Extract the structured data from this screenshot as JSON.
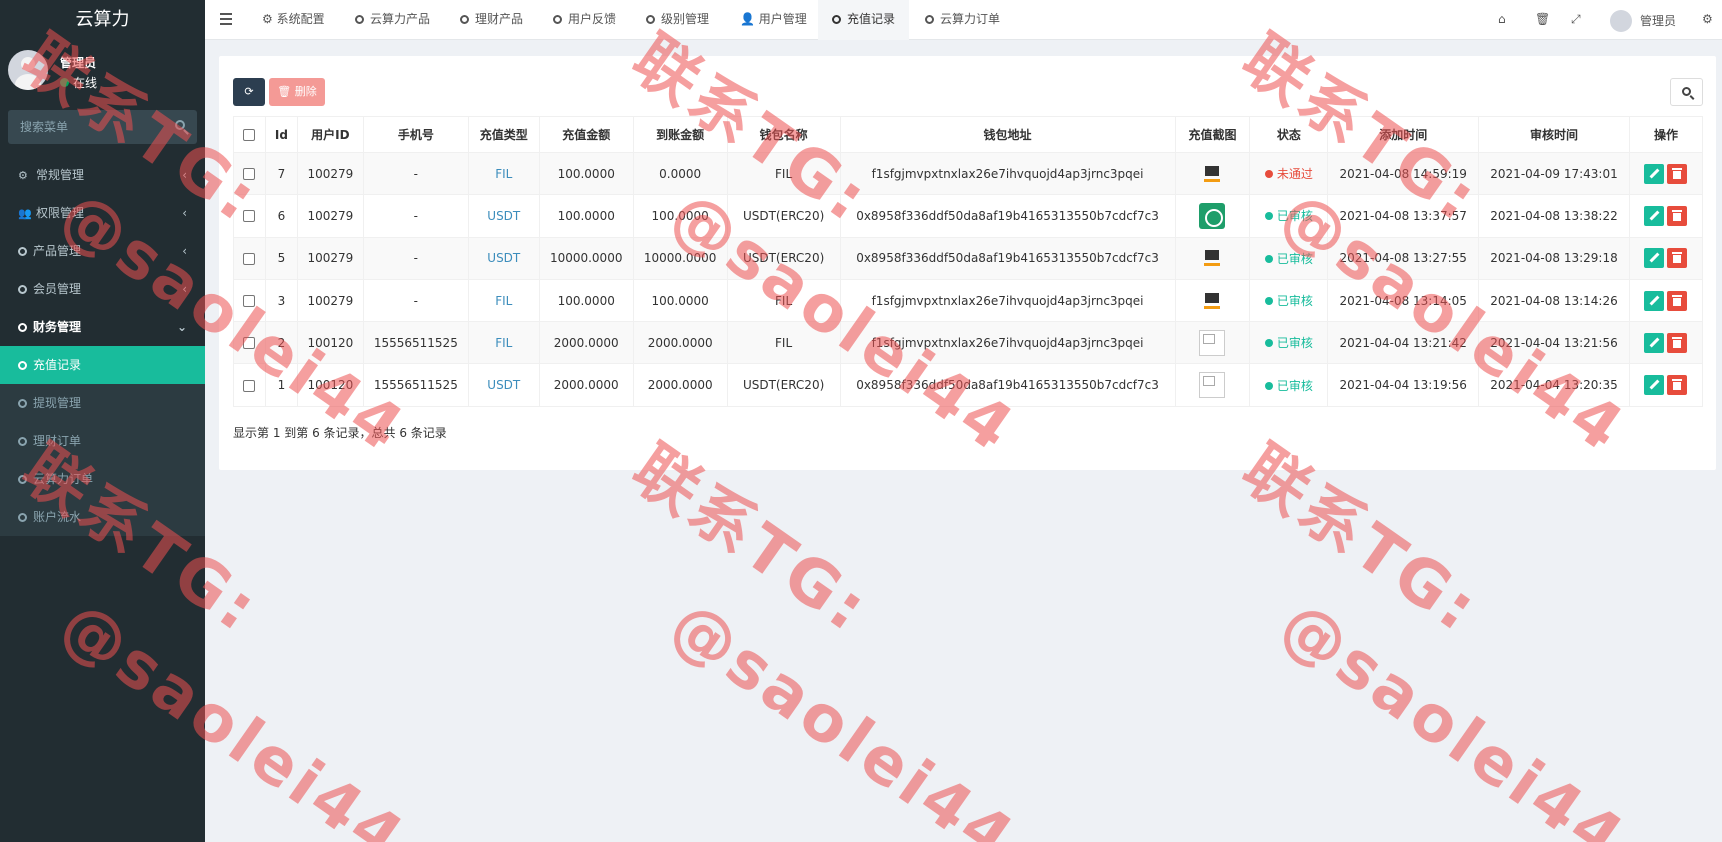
{
  "sidebar": {
    "brand": "云算力",
    "user": {
      "name": "管理员",
      "status": "在线"
    },
    "search_placeholder": "搜索菜单",
    "menu": [
      {
        "label": "常规管理",
        "icon": "cogs-icon"
      },
      {
        "label": "权限管理",
        "icon": "users-icon"
      },
      {
        "label": "产品管理",
        "icon": "circle-icon"
      },
      {
        "label": "会员管理",
        "icon": "circle-icon"
      },
      {
        "label": "财务管理",
        "icon": "circle-icon"
      }
    ],
    "submenu": [
      {
        "label": "充值记录"
      },
      {
        "label": "提现管理"
      },
      {
        "label": "理财订单"
      },
      {
        "label": "云算力订单"
      },
      {
        "label": "账户流水"
      }
    ]
  },
  "topnav": {
    "tabs": [
      {
        "label": "系统配置"
      },
      {
        "label": "云算力产品"
      },
      {
        "label": "理财产品"
      },
      {
        "label": "用户反馈"
      },
      {
        "label": "级别管理"
      },
      {
        "label": "用户管理"
      },
      {
        "label": "充值记录"
      },
      {
        "label": "云算力订单"
      }
    ],
    "user_name": "管理员"
  },
  "toolbar": {
    "delete_label": "删除"
  },
  "table": {
    "columns": [
      "Id",
      "用户ID",
      "手机号",
      "充值类型",
      "充值金额",
      "到账金额",
      "钱包名称",
      "钱包地址",
      "充值截图",
      "状态",
      "添加时间",
      "审核时间",
      "操作"
    ],
    "rows": [
      {
        "id": "7",
        "uid": "100279",
        "phone": "-",
        "type": "FIL",
        "amount": "100.0000",
        "credited": "0.0000",
        "wallet": "FIL",
        "address": "f1sfgjmvpxtnxlax26e7ihvquojd4ap3jrnc3pqei",
        "shot": "monitor",
        "status": "未通过",
        "status_kind": "rej",
        "added": "2021-04-08 14:59:19",
        "reviewed": "2021-04-09 17:43:01"
      },
      {
        "id": "6",
        "uid": "100279",
        "phone": "-",
        "type": "USDT",
        "amount": "100.0000",
        "credited": "100.0000",
        "wallet": "USDT(ERC20)",
        "address": "0x8958f336ddf50da8af19b4165313550b7cdcf7c3",
        "shot": "green",
        "status": "已审核",
        "status_kind": "ok",
        "added": "2021-04-08 13:37:57",
        "reviewed": "2021-04-08 13:38:22"
      },
      {
        "id": "5",
        "uid": "100279",
        "phone": "-",
        "type": "USDT",
        "amount": "10000.0000",
        "credited": "10000.0000",
        "wallet": "USDT(ERC20)",
        "address": "0x8958f336ddf50da8af19b4165313550b7cdcf7c3",
        "shot": "monitor",
        "status": "已审核",
        "status_kind": "ok",
        "added": "2021-04-08 13:27:55",
        "reviewed": "2021-04-08 13:29:18"
      },
      {
        "id": "3",
        "uid": "100279",
        "phone": "-",
        "type": "FIL",
        "amount": "100.0000",
        "credited": "100.0000",
        "wallet": "FIL",
        "address": "f1sfgjmvpxtnxlax26e7ihvquojd4ap3jrnc3pqei",
        "shot": "monitor",
        "status": "已审核",
        "status_kind": "ok",
        "added": "2021-04-08 13:14:05",
        "reviewed": "2021-04-08 13:14:26"
      },
      {
        "id": "2",
        "uid": "100120",
        "phone": "15556511525",
        "type": "FIL",
        "amount": "2000.0000",
        "credited": "2000.0000",
        "wallet": "FIL",
        "address": "f1sfgjmvpxtnxlax26e7ihvquojd4ap3jrnc3pqei",
        "shot": "broken",
        "status": "已审核",
        "status_kind": "ok",
        "added": "2021-04-04 13:21:42",
        "reviewed": "2021-04-04 13:21:56"
      },
      {
        "id": "1",
        "uid": "100120",
        "phone": "15556511525",
        "type": "USDT",
        "amount": "2000.0000",
        "credited": "2000.0000",
        "wallet": "USDT(ERC20)",
        "address": "0x8958f336ddf50da8af19b4165313550b7cdcf7c3",
        "shot": "broken",
        "status": "已审核",
        "status_kind": "ok",
        "added": "2021-04-04 13:19:56",
        "reviewed": "2021-04-04 13:20:35"
      }
    ]
  },
  "pager": {
    "info": "显示第 1 到第 6 条记录，总共 6 条记录"
  },
  "watermark": {
    "line1": "联系TG:",
    "line2": "@saolei44"
  },
  "colors": {
    "accent": "#18bc9c",
    "sidebar": "#222d32",
    "danger": "#e74c3c",
    "primary_dark": "#2c3e50"
  }
}
